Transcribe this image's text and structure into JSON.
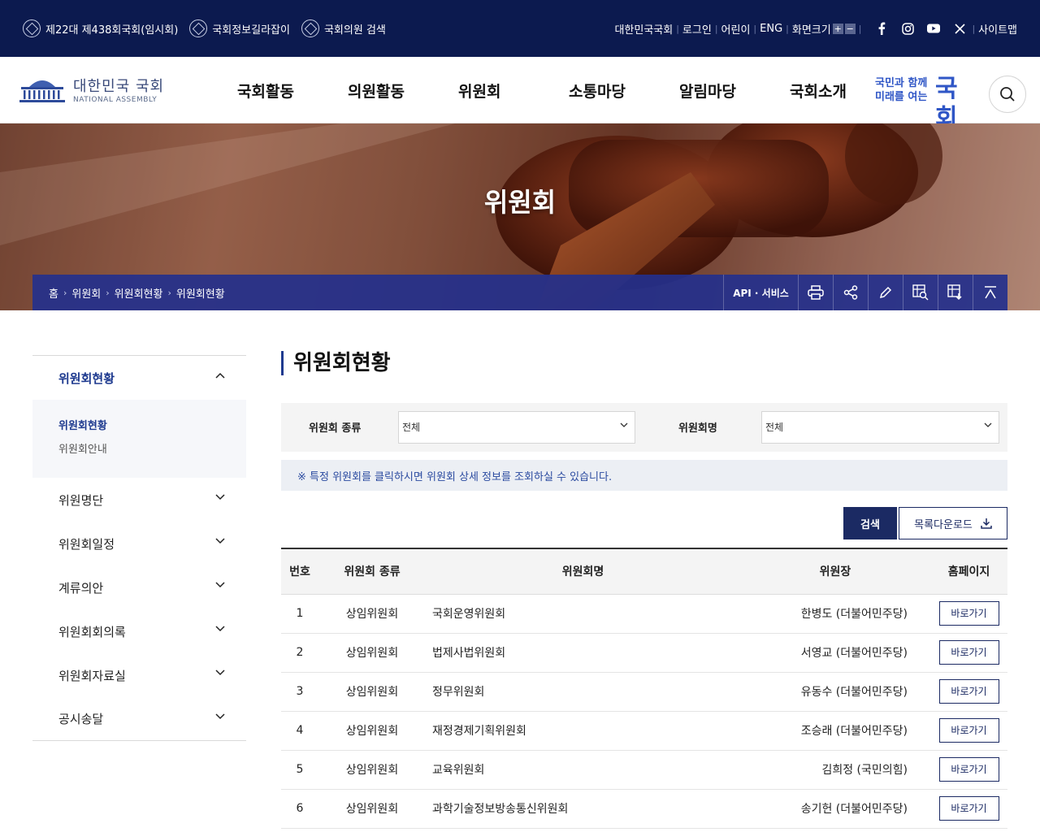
{
  "topbar": {
    "left_links": [
      "제22대 제438회국회(임시회)",
      "국회정보길라잡이",
      "국회의원 검색"
    ],
    "right_links": [
      "대한민국국회",
      "로그인",
      "어린이",
      "ENG",
      "화면크기"
    ],
    "zoom_in": "+",
    "zoom_out": "−",
    "sitemap": "사이트맵"
  },
  "logo": {
    "name": "대한민국 국회",
    "sub": "NATIONAL ASSEMBLY"
  },
  "nav": [
    "국회활동",
    "의원활동",
    "위원회",
    "소통마당",
    "알림마당",
    "국회소개"
  ],
  "slogan": {
    "line1": "국민과 함께",
    "line2": "미래를 여는",
    "big": "국회"
  },
  "hero": {
    "title": "위원회"
  },
  "breadcrumb": [
    "홈",
    "위원회",
    "위원회현황",
    "위원회현황"
  ],
  "tools": {
    "api": "API · 서비스"
  },
  "lnb": {
    "active_group": "위원회현황",
    "sub_items": [
      "위원회현황",
      "위원회안내"
    ],
    "groups": [
      "위원명단",
      "위원회일정",
      "계류의안",
      "위원회회의록",
      "위원회자료실",
      "공시송달"
    ]
  },
  "content": {
    "title": "위원회현황",
    "filter": {
      "type_label": "위원회 종류",
      "type_value": "전체",
      "name_label": "위원회명",
      "name_value": "전체"
    },
    "notice": "※ 특정 위원회를 클릭하시면 위원회 상세 정보를 조회하실 수 있습니다.",
    "search_button": "검색",
    "download_button": "목록다운로드"
  },
  "table": {
    "headers": [
      "번호",
      "위원회 종류",
      "위원회명",
      "위원장",
      "홈페이지"
    ],
    "rows": [
      {
        "no": "1",
        "type": "상임위원회",
        "name": "국회운영위원회",
        "chair": "한병도 (더불어민주당)",
        "link": "바로가기"
      },
      {
        "no": "2",
        "type": "상임위원회",
        "name": "법제사법위원회",
        "chair": "서영교 (더불어민주당)",
        "link": "바로가기"
      },
      {
        "no": "3",
        "type": "상임위원회",
        "name": "정무위원회",
        "chair": "유동수 (더불어민주당)",
        "link": "바로가기"
      },
      {
        "no": "4",
        "type": "상임위원회",
        "name": "재정경제기획위원회",
        "chair": "조승래 (더불어민주당)",
        "link": "바로가기"
      },
      {
        "no": "5",
        "type": "상임위원회",
        "name": "교육위원회",
        "chair": "김희정 (국민의힘)",
        "link": "바로가기"
      },
      {
        "no": "6",
        "type": "상임위원회",
        "name": "과학기술정보방송통신위원회",
        "chair": "송기헌 (더불어민주당)",
        "link": "바로가기"
      }
    ]
  }
}
